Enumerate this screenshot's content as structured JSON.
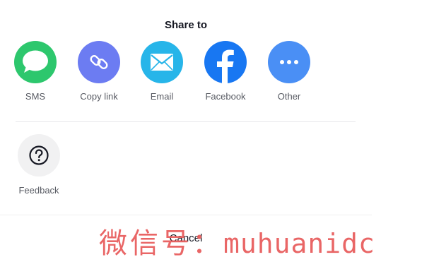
{
  "sheet": {
    "title": "Share to",
    "cancel_label": "Cancel"
  },
  "share_targets": [
    {
      "label": "SMS",
      "icon": "sms-icon",
      "color": "#2dc76d"
    },
    {
      "label": "Copy link",
      "icon": "link-icon",
      "color": "#6c7cf2"
    },
    {
      "label": "Email",
      "icon": "email-icon",
      "color": "#27b5e9"
    },
    {
      "label": "Facebook",
      "icon": "facebook-icon",
      "color": "#1877f2"
    },
    {
      "label": "Other",
      "icon": "more-icon",
      "color": "#4a8ff5"
    }
  ],
  "actions": [
    {
      "label": "Feedback",
      "icon": "question-icon",
      "color": "#f1f1f2"
    }
  ],
  "watermark": {
    "prefix": "微信号：",
    "handle": "muhuanidc",
    "color": "#e85a5a"
  }
}
